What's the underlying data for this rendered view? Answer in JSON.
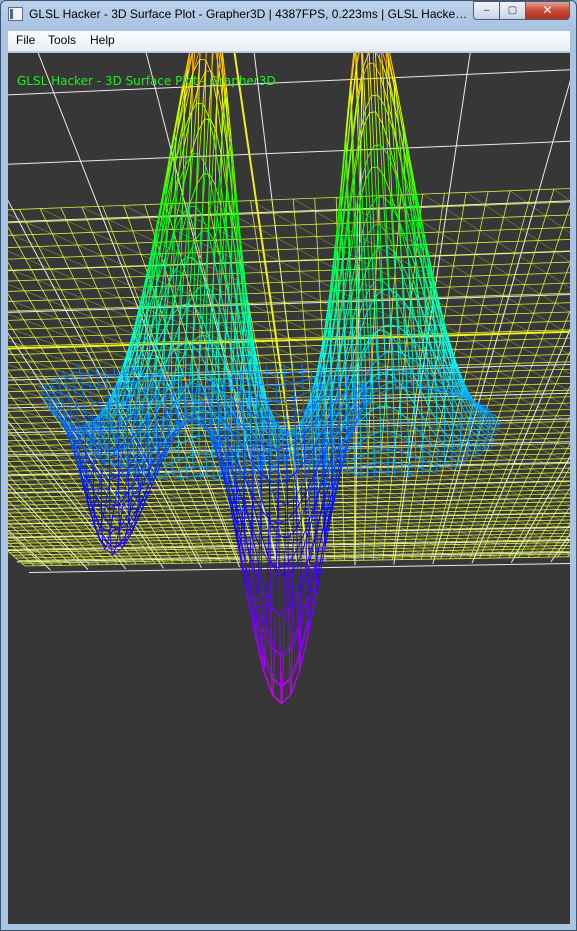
{
  "window": {
    "title": "GLSL Hacker - 3D Surface Plot - Grapher3D | 4387FPS, 0.223ms | GLSL Hacker BE...",
    "minimize_glyph": "‒",
    "maximize_glyph": "▢",
    "close_glyph": "✕"
  },
  "menu": {
    "file": "File",
    "tools": "Tools",
    "help": "Help"
  },
  "scene": {
    "overlay_title": "GLSL Hacker - 3D Surface Plot - Grapher3D",
    "background_color": "#373737",
    "grid_color": "#ffffff",
    "axis_color": "#f0f020",
    "plane_mesh_color": "#e8ff40",
    "overlay_text_color": "#22ee22"
  }
}
